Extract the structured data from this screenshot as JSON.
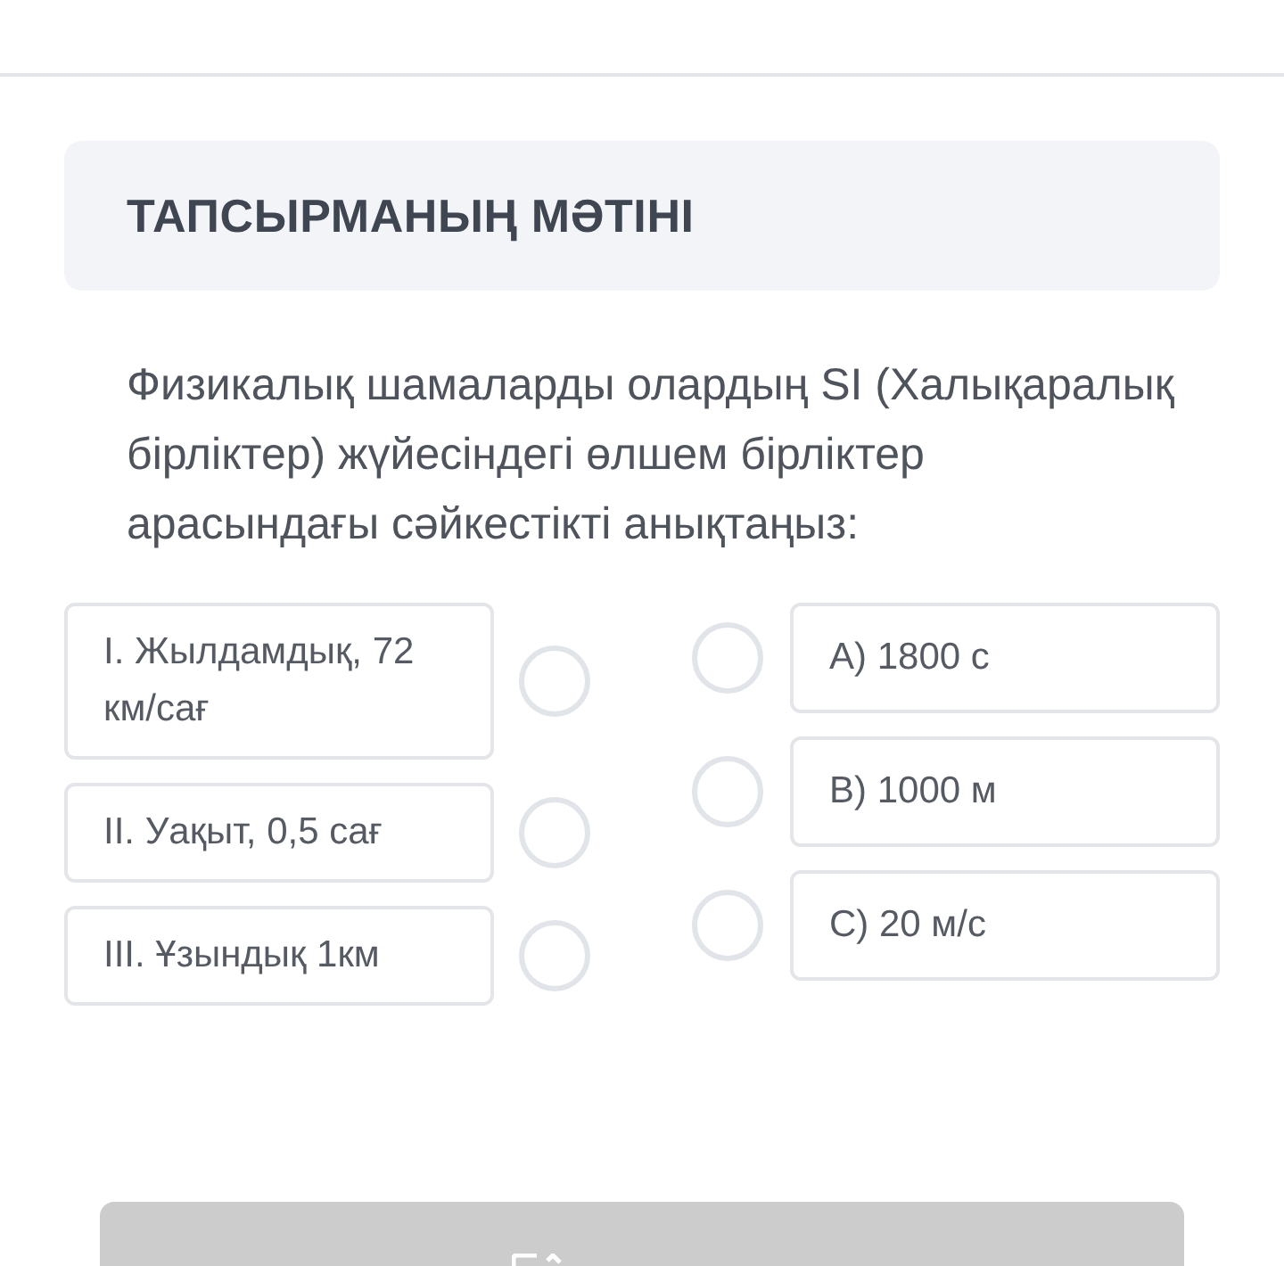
{
  "header": {
    "title": "ТАПСЫРМАНЫҢ МӘТІНІ"
  },
  "question": "Физикалық шамаларды олардың SI (Халықаралық бірліктер) жүйесіндегі өлшем бірліктер арасындағы сәйкестікті анықтаңыз:",
  "left_items": [
    {
      "label": "I. Жылдамдық, 72 км/сағ",
      "selected": false
    },
    {
      "label": "II. Уақыт, 0,5 сағ",
      "selected": false
    },
    {
      "label": "III. Ұзындық 1км",
      "selected": false
    }
  ],
  "right_items": [
    {
      "label": "A) 1800 с",
      "selected": false
    },
    {
      "label": "B) 1000 м",
      "selected": false
    },
    {
      "label": "C) 20 м/с",
      "selected": false
    }
  ],
  "submit_button": {
    "disabled": true
  }
}
